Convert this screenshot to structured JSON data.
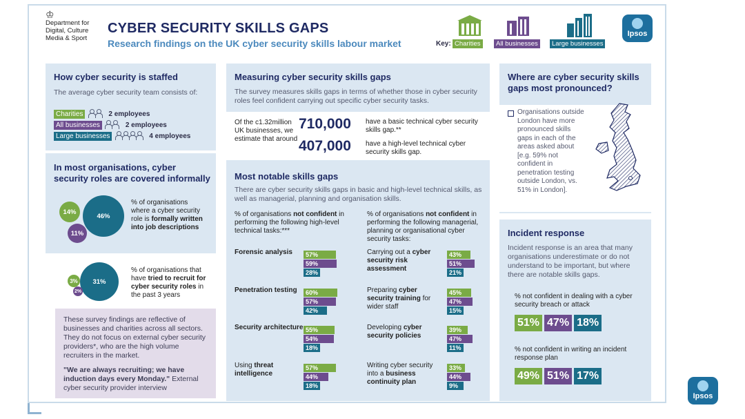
{
  "header": {
    "dept": [
      "Department for",
      "Digital, Culture",
      "Media & Sport"
    ],
    "title": "CYBER SECURITY SKILLS GAPS",
    "subtitle": "Research findings on the UK cyber security skills labour market",
    "key_label": "Key:",
    "key": [
      "Charities",
      "All businesses",
      "Large businesses"
    ],
    "logo": "Ipsos"
  },
  "colors": {
    "charities": "#7aab45",
    "all_businesses": "#6d4c8e",
    "large_businesses": "#1b6d88",
    "panel": "#dbe7f2",
    "title": "#1f2a63",
    "subtitle": "#4b89bd"
  },
  "staffed": {
    "title": "How cyber security is staffed",
    "intro": "The average cyber security team consists of:",
    "rows": [
      {
        "label": "Charities",
        "people": 2,
        "value": "2 employees"
      },
      {
        "label": "All businesses",
        "people": 2,
        "value": "2 employees"
      },
      {
        "label": "Large businesses",
        "people": 4,
        "value": "4 employees"
      }
    ]
  },
  "informal": {
    "title": "In most organisations, cyber security roles are covered informally",
    "job": {
      "values": [
        "14%",
        "46%",
        "11%"
      ],
      "text_a": "% of organisations where a cyber security role is ",
      "text_b": "formally written into job descriptions"
    },
    "recruit": {
      "values": [
        "3%",
        "31%",
        "2%"
      ],
      "text_a": "% of organisations that have ",
      "text_b": "tried to recruit for cyber security roles",
      "text_c": " in the past 3 years"
    },
    "note": "These survey findings are reflective of businesses and charities across all sectors. They do not focus on external cyber security providers*, who are the high volume recruiters in the market.",
    "quote_bold": "\"We are always recruiting; we have induction days every Monday.\"",
    "quote_rest": " External cyber security provider interview"
  },
  "measuring": {
    "title": "Measuring cyber security skills gaps",
    "intro": "The survey measures skills gaps in terms of whether those in cyber security roles feel confident carrying out specific cyber security tasks.",
    "lead": "Of the c1.32million UK businesses, we estimate that around",
    "stats": [
      {
        "value": "710,000",
        "text": "have a basic technical cyber security skills gap.**"
      },
      {
        "value": "407,000",
        "text": "have a high-level technical cyber security skills gap."
      }
    ]
  },
  "notable": {
    "title": "Most notable skills gaps",
    "intro": "There are cyber security skills gaps in basic and high-level technical skills, as well as managerial, planning and organisation skills.",
    "left_header_a": "% of organisations ",
    "left_header_b": "not confident",
    "left_header_c": " in performing the following high-level technical tasks:***",
    "right_header_a": "% of organisations ",
    "right_header_b": "not confident",
    "right_header_c": " in performing the following managerial, planning or organisational cyber security tasks:",
    "left_items": [
      {
        "label_a": "",
        "label_b": "Forensic analysis",
        "values": [
          57,
          59,
          28
        ]
      },
      {
        "label_a": "",
        "label_b": "Penetration testing",
        "values": [
          60,
          57,
          42
        ]
      },
      {
        "label_a": "",
        "label_b": "Security architecture",
        "values": [
          55,
          54,
          18
        ]
      },
      {
        "label_a": "Using ",
        "label_b": "threat intelligence",
        "values": [
          57,
          44,
          18
        ]
      }
    ],
    "right_items": [
      {
        "label_a": "Carrying out a ",
        "label_b": "cyber security risk assessment",
        "values": [
          43,
          51,
          21
        ]
      },
      {
        "label_a": "Preparing ",
        "label_b": "cyber security training",
        "label_c": " for wider staff",
        "values": [
          45,
          47,
          15
        ]
      },
      {
        "label_a": "Developing ",
        "label_b": "cyber security policies",
        "values": [
          39,
          47,
          11
        ]
      },
      {
        "label_a": "Writing cyber security into a ",
        "label_b": "business continuity plan",
        "values": [
          33,
          44,
          9
        ]
      }
    ]
  },
  "where": {
    "title": "Where are cyber security skills gaps most pronounced?",
    "text": "Organisations outside London have more pronounced skills gaps in each of the areas asked about [e.g. 59% not confident in penetration testing outside London, vs. 51% in London]."
  },
  "incident": {
    "title": "Incident response",
    "intro": "Incident response is an area that many organisations underestimate or do not understand to be important, but where there are notable skills gaps.",
    "q1": "% not confident in dealing with a cyber security breach or attack",
    "v1": [
      "51%",
      "47%",
      "18%"
    ],
    "q2": "% not confident in writing an incident response plan",
    "v2": [
      "49%",
      "51%",
      "17%"
    ]
  }
}
